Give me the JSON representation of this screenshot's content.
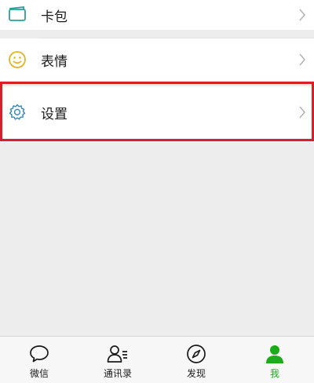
{
  "menu": {
    "items": [
      {
        "label": "卡包",
        "icon": "card-wallet-icon"
      },
      {
        "label": "表情",
        "icon": "smiley-icon"
      },
      {
        "label": "设置",
        "icon": "gear-icon"
      }
    ]
  },
  "tabbar": {
    "tabs": [
      {
        "label": "微信",
        "icon": "chat-bubble-icon",
        "active": false
      },
      {
        "label": "通讯录",
        "icon": "contacts-icon",
        "active": false
      },
      {
        "label": "发现",
        "icon": "compass-icon",
        "active": false
      },
      {
        "label": "我",
        "icon": "person-icon",
        "active": true
      }
    ]
  },
  "colors": {
    "accent": "#1aad19",
    "highlight": "#d9202a",
    "card_icon": "#2aa198",
    "smiley_icon": "#e6b422",
    "gear_icon": "#3a8fb7"
  }
}
